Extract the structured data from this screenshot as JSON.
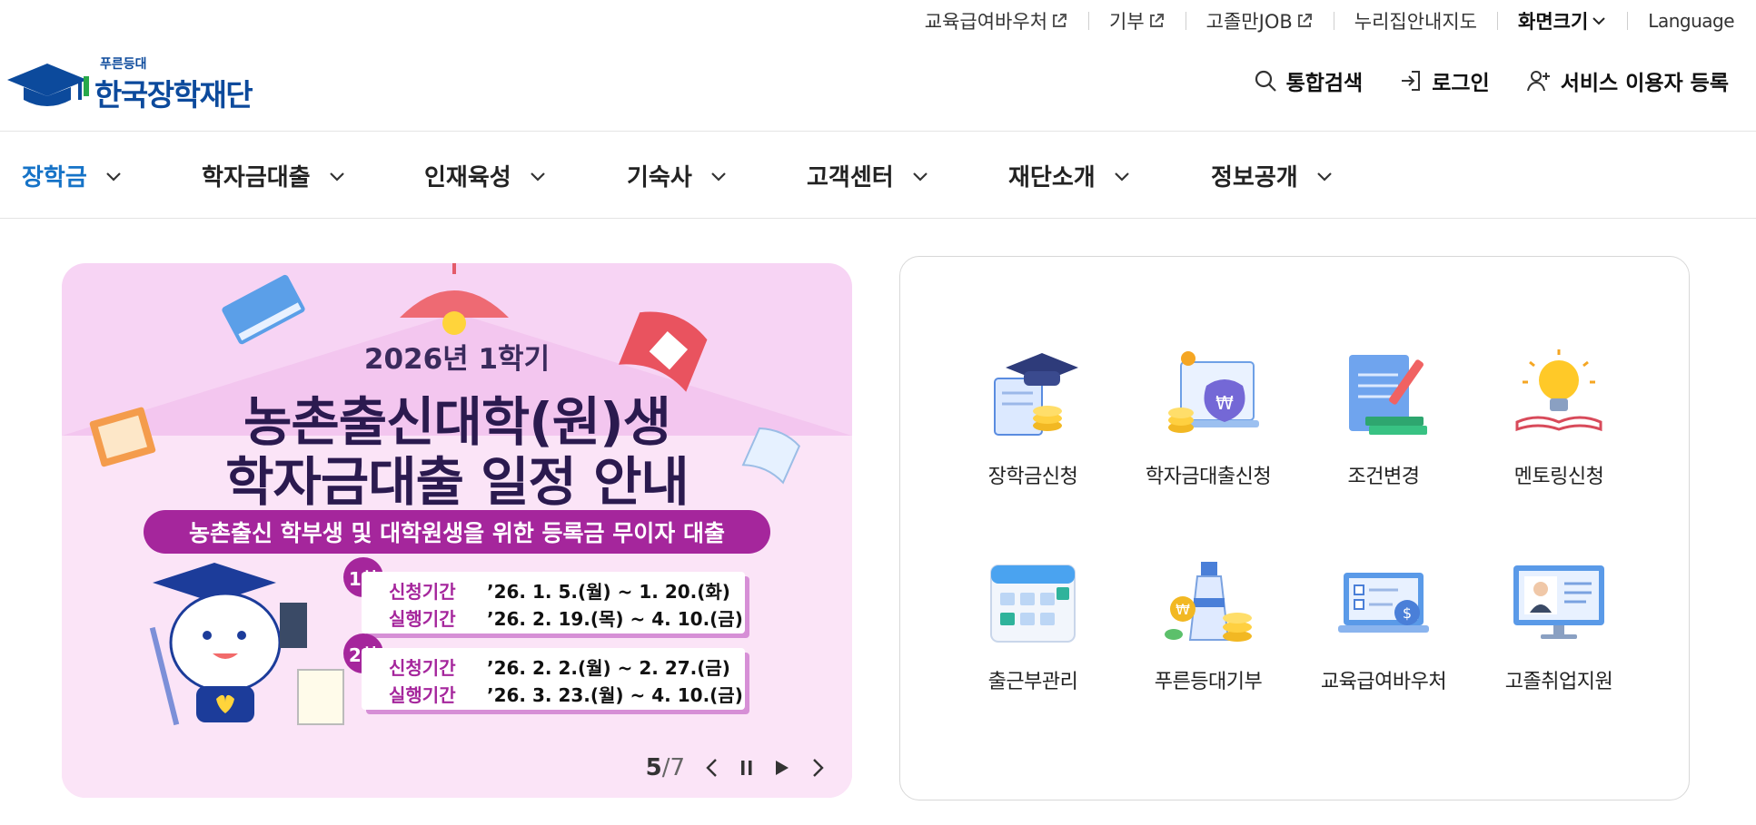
{
  "utility_links": [
    {
      "label": "교육급여바우처",
      "external": true
    },
    {
      "label": "기부",
      "external": true
    },
    {
      "label": "고졸만JOB",
      "external": true
    },
    {
      "label": "누리집안내지도",
      "external": false
    }
  ],
  "screen_size_label": "화면크기",
  "language_label": "Language",
  "logo": {
    "sub": "푸른등대",
    "main": "한국장학재단"
  },
  "user_menu": {
    "search": "통합검색",
    "login": "로그인",
    "register": "서비스 이용자 등록"
  },
  "nav": [
    {
      "label": "장학금",
      "active": true
    },
    {
      "label": "학자금대출",
      "active": false
    },
    {
      "label": "인재육성",
      "active": false
    },
    {
      "label": "기숙사",
      "active": false
    },
    {
      "label": "고객센터",
      "active": false
    },
    {
      "label": "재단소개",
      "active": false
    },
    {
      "label": "정보공개",
      "active": false
    }
  ],
  "banner": {
    "year": "2026년 1학기",
    "title_line1": "농촌출신대학(원)생",
    "title_line2": "학자금대출 일정 안내",
    "subtitle": "농촌출신 학부생 및 대학원생을 위한 등록금 무이자 대출",
    "rounds": [
      {
        "badge": "1차",
        "apply_label": "신청기간",
        "apply": "’26. 1. 5.(월) ~ 1. 20.(화)",
        "exec_label": "실행기간",
        "exec": "’26. 2. 19.(목) ~ 4. 10.(금)"
      },
      {
        "badge": "2차",
        "apply_label": "신청기간",
        "apply": "’26. 2. 2.(월) ~ 2. 27.(금)",
        "exec_label": "실행기간",
        "exec": "’26. 3. 23.(월) ~ 4. 10.(금)"
      }
    ],
    "current": "5",
    "total": "/7"
  },
  "quick_menu": [
    {
      "label": "장학금신청",
      "icon": "graduation-cap-icon"
    },
    {
      "label": "학자금대출신청",
      "icon": "money-bag-icon"
    },
    {
      "label": "조건변경",
      "icon": "document-edit-icon"
    },
    {
      "label": "멘토링신청",
      "icon": "lightbulb-book-icon"
    },
    {
      "label": "출근부관리",
      "icon": "calendar-icon"
    },
    {
      "label": "푸른등대기부",
      "icon": "lighthouse-coins-icon"
    },
    {
      "label": "교육급여바우처",
      "icon": "voucher-laptop-icon"
    },
    {
      "label": "고졸취업지원",
      "icon": "job-monitor-icon"
    }
  ],
  "colors": {
    "brand": "#0c4a9c",
    "accent_nav": "#1673c7",
    "banner_bg": "#f7d4f4",
    "banner_purple": "#a5269c"
  }
}
